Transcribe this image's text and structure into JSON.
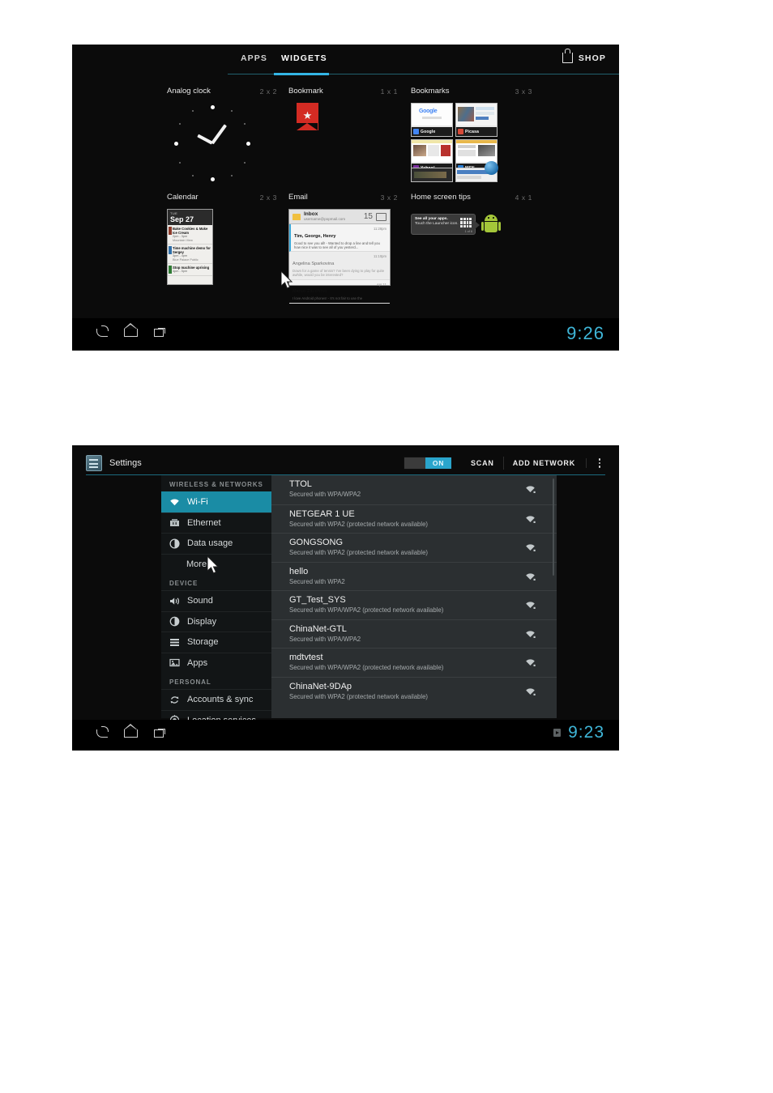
{
  "shot_widgets": {
    "tabs": [
      {
        "label": "APPS",
        "active": false
      },
      {
        "label": "WIDGETS",
        "active": true
      }
    ],
    "shop_label": "SHOP",
    "widgets": [
      {
        "title": "Analog clock",
        "size": "2 x 2"
      },
      {
        "title": "Bookmark",
        "size": "1 x 1"
      },
      {
        "title": "Bookmarks",
        "size": "3 x 3",
        "tiles": [
          {
            "label": "Google",
            "fav_color": "#4285f4"
          },
          {
            "label": "Picasa",
            "fav_color": "#d64937"
          },
          {
            "label": "Yahoo!",
            "fav_color": "#7b2fa0"
          },
          {
            "label": "MSN",
            "fav_color": "#2a7fd4"
          }
        ]
      },
      {
        "title": "Calendar",
        "size": "2 x 3",
        "day_of_week": "TUE",
        "date": "Sep 27",
        "events": [
          {
            "title": "Bake Cookies & Make Ice Cream",
            "time": "2pm - 3pm",
            "location": "Mountain View",
            "color": "#8d3b2a"
          },
          {
            "title": "Time machine demo for Sergey",
            "time": "3pm - 4pm",
            "location": "Blue Palace Public",
            "color": "#2f6fa8"
          },
          {
            "title": "Stop machine uprising",
            "time": "4pm - 5pm",
            "location": "",
            "color": "#2f7a34"
          }
        ]
      },
      {
        "title": "Email",
        "size": "3 x 2",
        "folder": "Inbox",
        "account": "username@popmail.com",
        "unread_count": "15",
        "messages": [
          {
            "from": "Tim, George, Henry",
            "time": "11:28pm",
            "snippet": "Good to see you all! - Wanted to drop a line and tell you how nice it was to see all of you yesterd...",
            "read": false
          },
          {
            "from": "Angelina Sparkovina",
            "time": "11:10pm",
            "snippet": "Down for a game of tennis? I've been dying to play for quite awhile, would you be interested?",
            "read": true
          },
          {
            "from": "Marco Zacchino",
            "time": "Apr 11",
            "snippet": "I love Android phones! - It's not fair to use the",
            "read": false
          }
        ]
      },
      {
        "title": "Home screen tips",
        "size": "4 x 1",
        "tip_line1": "See all your apps.",
        "tip_line2": "Touch the Launcher icon.",
        "tip_counter": "1 of 6"
      }
    ],
    "navbar": {
      "back_icon": "back-icon",
      "home_icon": "home-icon",
      "recents_icon": "recents-icon",
      "clock": "9:26"
    }
  },
  "shot_settings": {
    "actionbar": {
      "app_title": "Settings",
      "toggle_state": "ON",
      "scan_label": "SCAN",
      "add_network_label": "ADD NETWORK",
      "overflow_icon": "overflow-menu-icon"
    },
    "sidebar": [
      {
        "type": "group",
        "label": "WIRELESS & NETWORKS"
      },
      {
        "type": "item",
        "label": "Wi-Fi",
        "icon": "wifi-icon",
        "selected": true
      },
      {
        "type": "item",
        "label": "Ethernet",
        "icon": "ethernet-icon",
        "selected": false
      },
      {
        "type": "item",
        "label": "Data usage",
        "icon": "data-usage-icon",
        "selected": false
      },
      {
        "type": "item",
        "label": "More...",
        "icon": "",
        "selected": false,
        "indent": true
      },
      {
        "type": "group",
        "label": "DEVICE"
      },
      {
        "type": "item",
        "label": "Sound",
        "icon": "sound-icon",
        "selected": false
      },
      {
        "type": "item",
        "label": "Display",
        "icon": "display-icon",
        "selected": false
      },
      {
        "type": "item",
        "label": "Storage",
        "icon": "storage-icon",
        "selected": false
      },
      {
        "type": "item",
        "label": "Apps",
        "icon": "apps-icon",
        "selected": false
      },
      {
        "type": "group",
        "label": "PERSONAL"
      },
      {
        "type": "item",
        "label": "Accounts & sync",
        "icon": "sync-icon",
        "selected": false
      },
      {
        "type": "item",
        "label": "Location services",
        "icon": "location-icon",
        "selected": false
      }
    ],
    "networks": [
      {
        "ssid": "TTOL",
        "security": "Secured with WPA/WPA2"
      },
      {
        "ssid": "NETGEAR 1 UE",
        "security": "Secured with WPA2 (protected network available)"
      },
      {
        "ssid": "GONGSONG",
        "security": "Secured with WPA2 (protected network available)"
      },
      {
        "ssid": "hello",
        "security": "Secured with WPA2"
      },
      {
        "ssid": "GT_Test_SYS",
        "security": "Secured with WPA/WPA2 (protected network available)"
      },
      {
        "ssid": "ChinaNet-GTL",
        "security": "Secured with WPA/WPA2"
      },
      {
        "ssid": "mdtvtest",
        "security": "Secured with WPA/WPA2 (protected network available)"
      },
      {
        "ssid": "ChinaNet-9DAp",
        "security": "Secured with WPA2 (protected network available)"
      }
    ],
    "navbar": {
      "back_icon": "back-icon",
      "home_icon": "home-icon",
      "recents_icon": "recents-icon",
      "sd_icon": "sd-card-icon",
      "clock": "9:23"
    }
  },
  "colors": {
    "accent_cyan": "#33b5e5",
    "selected_teal": "#1a8ca5",
    "clock_cyan": "#3fb6d8",
    "screen_bg": "#0b0b0b",
    "list_bg": "#2b2f31"
  }
}
